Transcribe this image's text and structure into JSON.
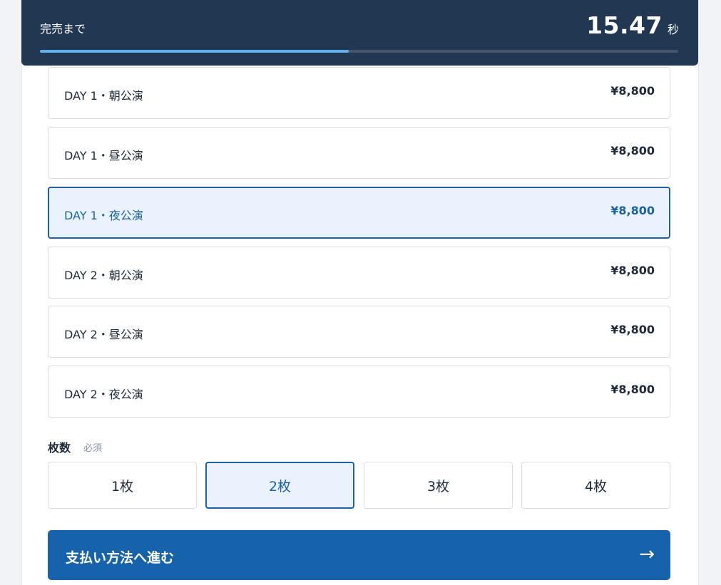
{
  "header": {
    "label": "完売まで",
    "timer_value": "15.47",
    "timer_unit": "秒",
    "progress": 0.484
  },
  "shows": [
    {
      "name": "DAY 1・朝公演",
      "price": "¥8,800",
      "selected": false
    },
    {
      "name": "DAY 1・昼公演",
      "price": "¥8,800",
      "selected": false
    },
    {
      "name": "DAY 1・夜公演",
      "price": "¥8,800",
      "selected": true
    },
    {
      "name": "DAY 2・朝公演",
      "price": "¥8,800",
      "selected": false
    },
    {
      "name": "DAY 2・昼公演",
      "price": "¥8,800",
      "selected": false
    },
    {
      "name": "DAY 2・夜公演",
      "price": "¥8,800",
      "selected": false
    }
  ],
  "quantity": {
    "label": "枚数",
    "required": "必須",
    "options": [
      "1枚",
      "2枚",
      "3枚",
      "4枚"
    ],
    "selected_index": 1
  },
  "submit": {
    "label": "支払い方法へ進む",
    "arrow": "→"
  },
  "colors": {
    "header_bg": "#223751",
    "accent": "#1c61a3",
    "progress_fill": "#5fb0ef",
    "button_bg": "#1763ab"
  }
}
